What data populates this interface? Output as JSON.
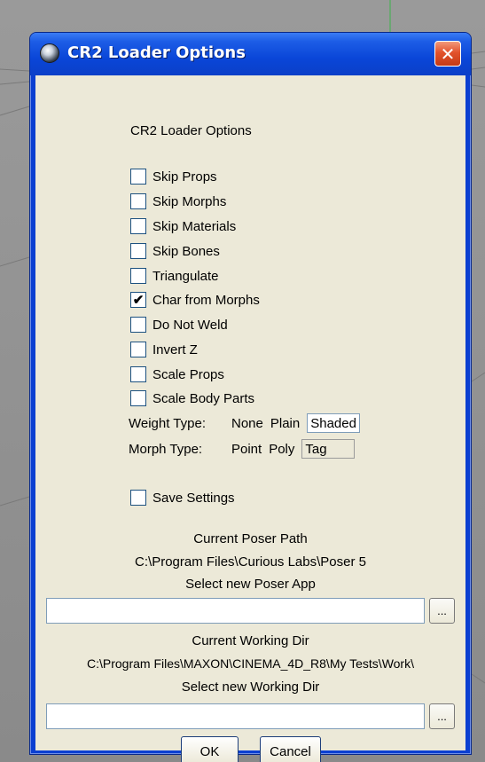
{
  "window": {
    "title": "CR2 Loader Options",
    "close_glyph": "✕"
  },
  "dialog": {
    "heading": "CR2 Loader Options",
    "options": [
      {
        "label": "Skip Props",
        "checked": false
      },
      {
        "label": "Skip Morphs",
        "checked": false
      },
      {
        "label": "Skip Materials",
        "checked": false
      },
      {
        "label": "Skip Bones",
        "checked": false
      },
      {
        "label": "Triangulate",
        "checked": false
      },
      {
        "label": "Char from Morphs",
        "checked": true
      },
      {
        "label": "Do Not Weld",
        "checked": false
      },
      {
        "label": "Invert Z",
        "checked": false
      },
      {
        "label": "Scale Props",
        "checked": false
      },
      {
        "label": "Scale Body Parts",
        "checked": false
      }
    ],
    "weight_type": {
      "label": "Weight Type:",
      "options": [
        "None",
        "Plain",
        "Shaded"
      ],
      "selected": "Shaded"
    },
    "morph_type": {
      "label": "Morph Type:",
      "options": [
        "Point",
        "Poly",
        "Tag"
      ],
      "selected": "Tag"
    },
    "save_settings": {
      "label": "Save Settings",
      "checked": false
    },
    "poser": {
      "current_label": "Current Poser Path",
      "current_value": "C:\\Program Files\\Curious Labs\\Poser 5",
      "select_label": "Select new Poser App",
      "input_value": "",
      "browse_label": "..."
    },
    "working": {
      "current_label": "Current Working Dir",
      "current_value": "C:\\Program Files\\MAXON\\CINEMA_4D_R8\\My Tests\\Work\\",
      "select_label": "Select new Working Dir",
      "input_value": "",
      "browse_label": "..."
    },
    "ok_label": "OK",
    "cancel_label": "Cancel"
  },
  "colors": {
    "titlebar": "#0a46d8",
    "client": "#ece9d8",
    "close": "#e2532c"
  },
  "icons": {
    "app": "cinema4d-sphere-icon",
    "close": "close-icon",
    "check": "checkmark-icon"
  }
}
